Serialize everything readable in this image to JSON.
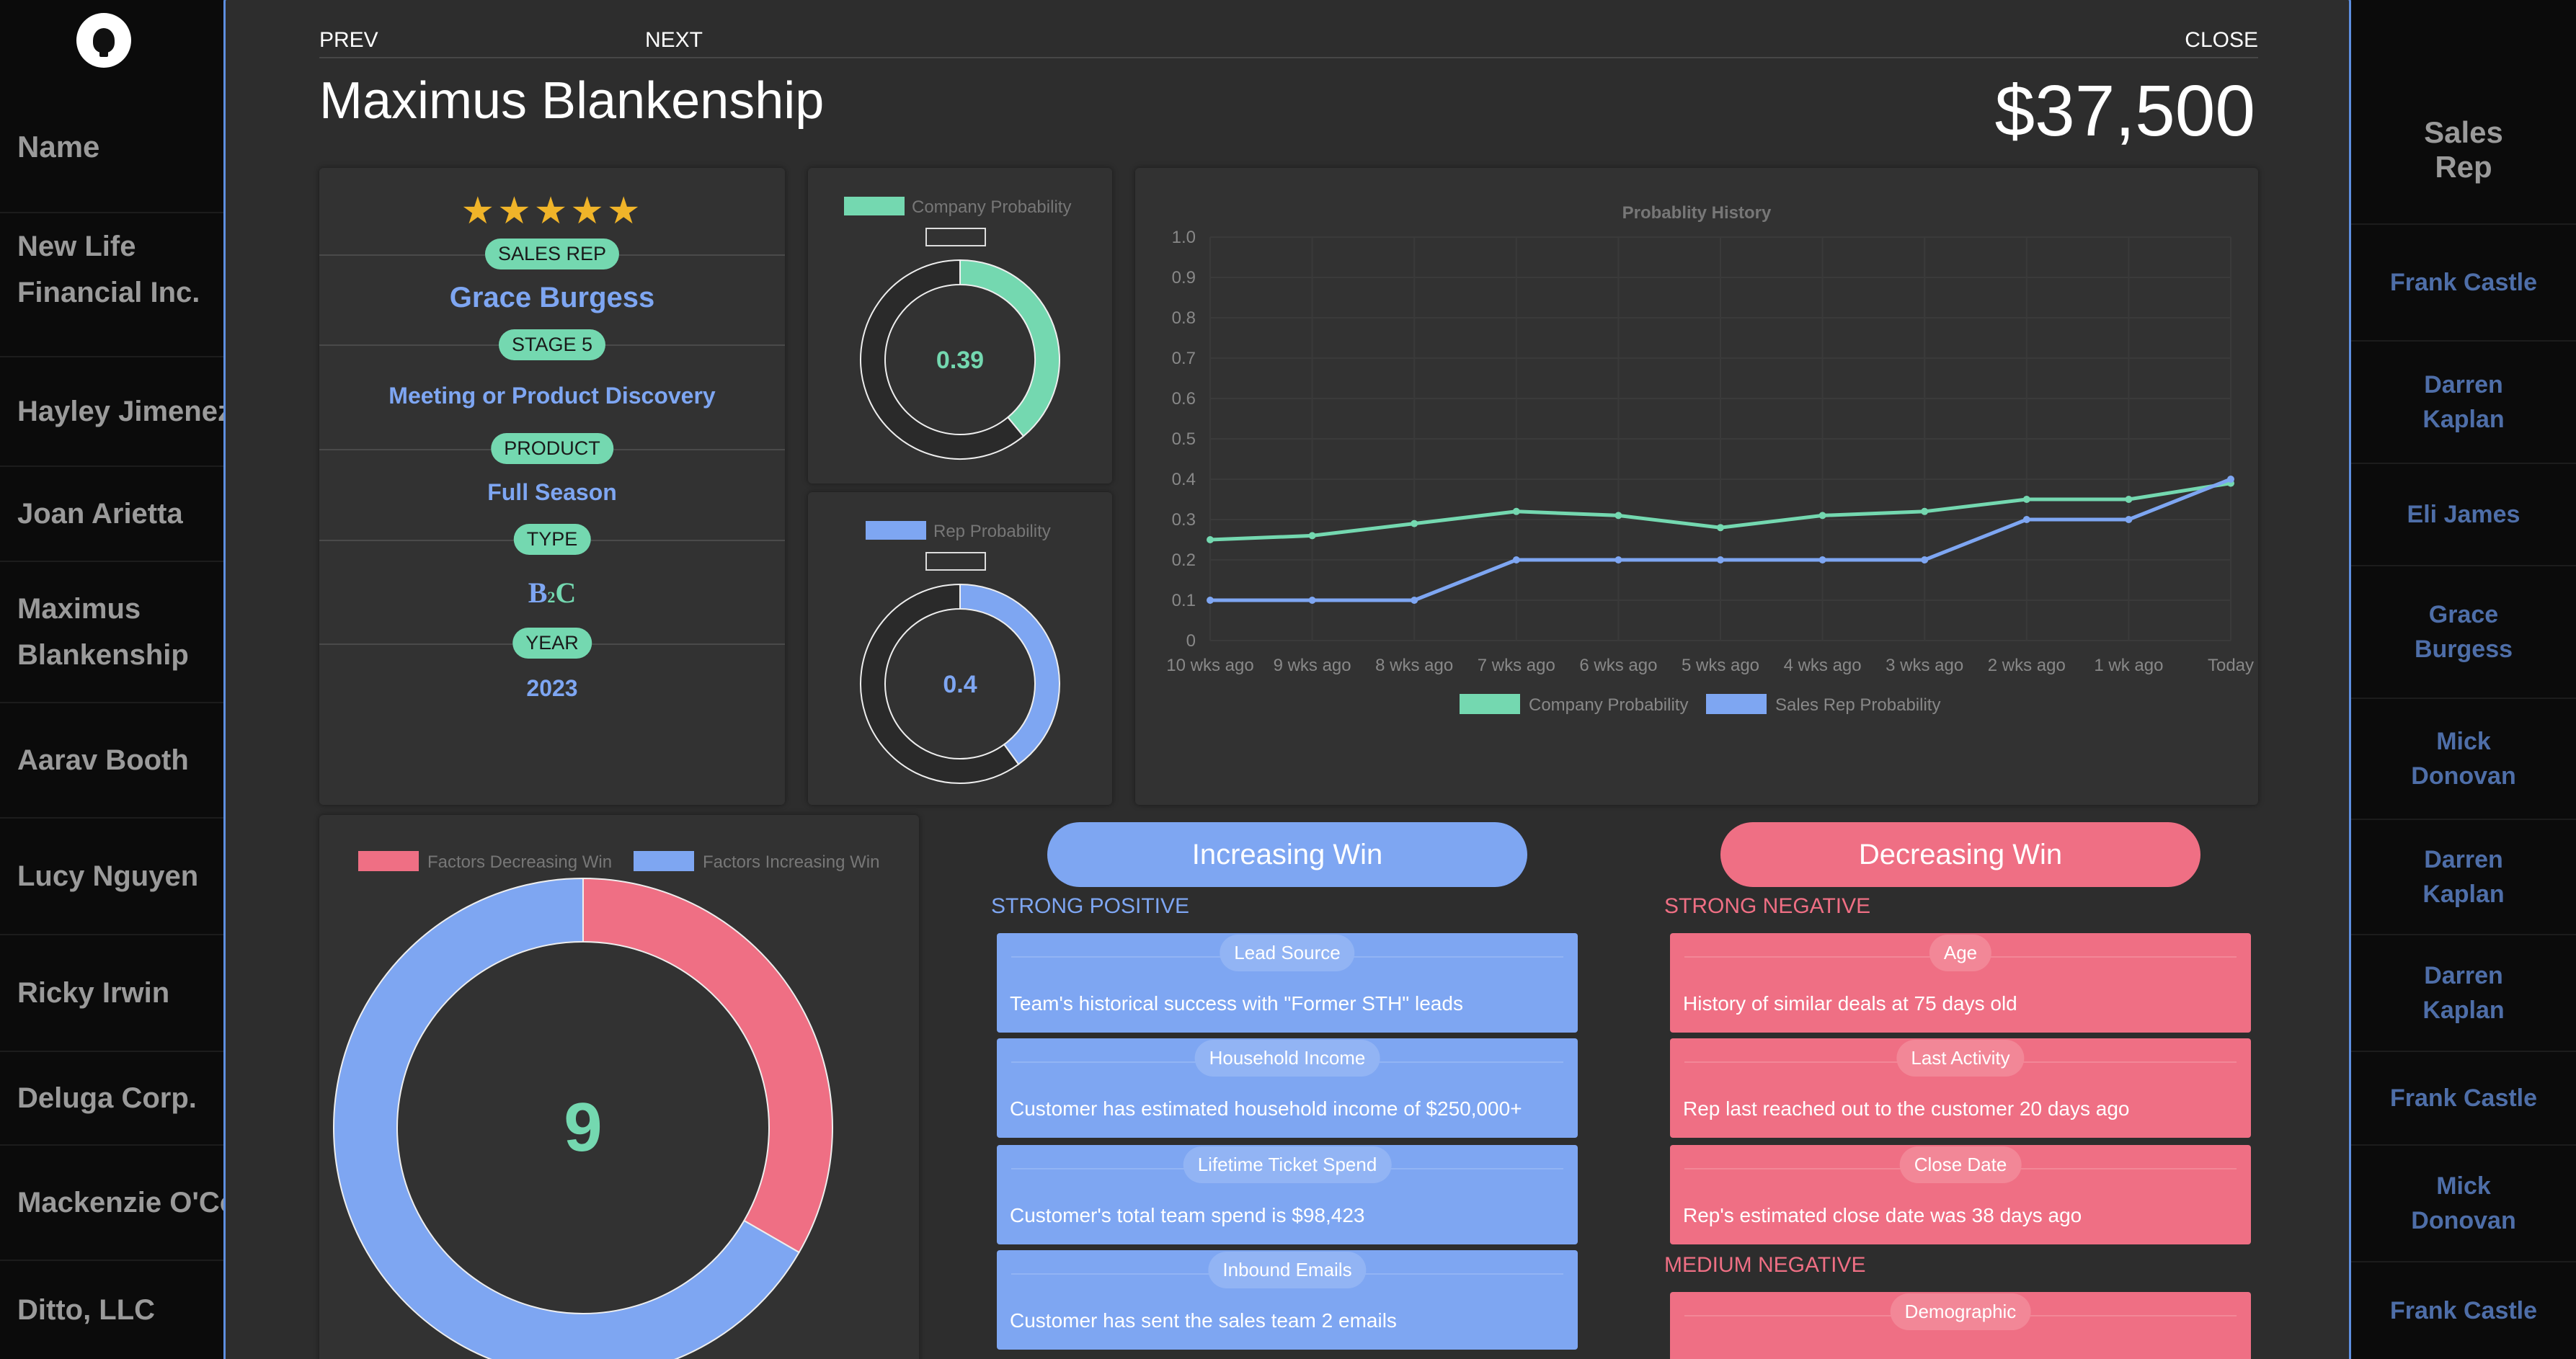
{
  "background_list": {
    "name_header": "Name",
    "rep_header": "Sales Rep",
    "rows": [
      {
        "name": "New Life Financial Inc.",
        "rep": "Frank Castle"
      },
      {
        "name": "Hayley Jimenez",
        "rep": "Darren Kaplan"
      },
      {
        "name": "Joan Arietta",
        "rep": "Eli James"
      },
      {
        "name": "Maximus Blankenship",
        "rep": "Grace Burgess"
      },
      {
        "name": "Aarav Booth",
        "rep": "Mick Donovan"
      },
      {
        "name": "Lucy Nguyen",
        "rep": "Darren Kaplan"
      },
      {
        "name": "Ricky Irwin",
        "rep": "Darren Kaplan"
      },
      {
        "name": "Deluga Corp.",
        "rep": "Frank Castle"
      },
      {
        "name": "Mackenzie O'Connor",
        "rep": "Mick Donovan"
      },
      {
        "name": "Ditto, LLC",
        "rep": "Frank Castle"
      }
    ]
  },
  "nav": {
    "prev": "PREV",
    "next": "NEXT",
    "close": "CLOSE"
  },
  "deal": {
    "name": "Maximus Blankenship",
    "amount": "$37,500"
  },
  "info": {
    "stars": "★★★★★",
    "sales_rep_label": "SALES REP",
    "sales_rep": "Grace Burgess",
    "stage_label": "STAGE 5",
    "stage": "Meeting or Product Discovery",
    "product_label": "PRODUCT",
    "product": "Full Season",
    "type_label": "TYPE",
    "type_b": "B",
    "type_c": "C",
    "year_label": "YEAR",
    "year": "2023"
  },
  "colors": {
    "green": "#74d8b0",
    "blue": "#7ea6f2",
    "red": "#ef6f84"
  },
  "chart_data": [
    {
      "type": "pie",
      "legend": [
        "Company Probability"
      ],
      "values": [
        0.39,
        0.61
      ],
      "center_label": "0.39"
    },
    {
      "type": "pie",
      "legend": [
        "Rep Probability"
      ],
      "values": [
        0.4,
        0.6
      ],
      "center_label": "0.4"
    },
    {
      "type": "line",
      "title": "Probablity History",
      "categories": [
        "10 wks ago",
        "9 wks ago",
        "8 wks ago",
        "7 wks ago",
        "6 wks ago",
        "5 wks ago",
        "4 wks ago",
        "3 wks ago",
        "2 wks ago",
        "1 wk ago",
        "Today"
      ],
      "ylim": [
        0,
        1.0
      ],
      "yticks": [
        "0",
        "0.1",
        "0.2",
        "0.3",
        "0.4",
        "0.5",
        "0.6",
        "0.7",
        "0.8",
        "0.9",
        "1.0"
      ],
      "legend_position": "bottom",
      "grid": true,
      "series": [
        {
          "name": "Company Probability",
          "values": [
            0.25,
            0.26,
            0.29,
            0.32,
            0.31,
            0.28,
            0.31,
            0.32,
            0.35,
            0.35,
            0.39
          ]
        },
        {
          "name": "Sales Rep Probability",
          "values": [
            0.1,
            0.1,
            0.1,
            0.2,
            0.2,
            0.2,
            0.2,
            0.2,
            0.3,
            0.3,
            0.4
          ]
        }
      ]
    },
    {
      "type": "pie",
      "legend": [
        "Factors Decreasing Win",
        "Factors Increasing Win"
      ],
      "values": [
        3,
        6
      ],
      "center_label": "9"
    }
  ],
  "increasing": {
    "button": "Increasing Win",
    "section": "STRONG POSITIVE",
    "cards": [
      {
        "tag": "Lead Source",
        "text": "Team's historical success with \"Former STH\" leads"
      },
      {
        "tag": "Household Income",
        "text": "Customer has estimated household income of $250,000+"
      },
      {
        "tag": "Lifetime Ticket Spend",
        "text": "Customer's total team spend is $98,423"
      },
      {
        "tag": "Inbound Emails",
        "text": "Customer has sent the sales team 2 emails"
      }
    ]
  },
  "decreasing": {
    "button": "Decreasing Win",
    "section": "STRONG NEGATIVE",
    "section2": "MEDIUM NEGATIVE",
    "cards": [
      {
        "tag": "Age",
        "text": "History of similar deals at 75 days old"
      },
      {
        "tag": "Last Activity",
        "text": "Rep last reached out to the customer 20 days ago"
      },
      {
        "tag": "Close Date",
        "text": "Rep's estimated close date was 38 days ago"
      },
      {
        "tag": "Demographic",
        "text": ""
      }
    ]
  }
}
